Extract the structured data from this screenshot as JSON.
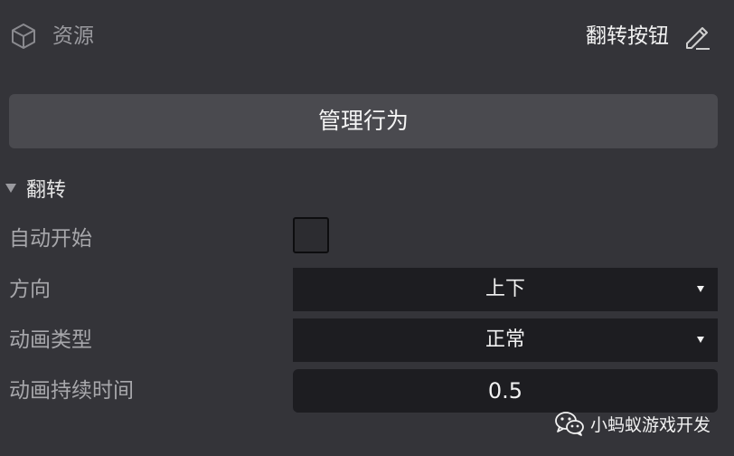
{
  "header": {
    "resource_icon": "cube-icon",
    "resource_label": "资源",
    "object_name": "翻转按钮",
    "edit_icon": "pencil-edit-icon"
  },
  "manage_button": {
    "label": "管理行为"
  },
  "section": {
    "title": "翻转",
    "expanded": true,
    "fields": {
      "auto_start": {
        "label": "自动开始",
        "checked": false
      },
      "direction": {
        "label": "方向",
        "value": "上下"
      },
      "animation_type": {
        "label": "动画类型",
        "value": "正常"
      },
      "duration": {
        "label": "动画持续时间",
        "value": "0.5"
      }
    }
  },
  "watermark": {
    "icon": "wechat-icon",
    "text": "小蚂蚁游戏开发"
  },
  "colors": {
    "panel_bg": "#343439",
    "button_bg": "#4a4a4f",
    "field_bg": "#1d1d21",
    "label_text": "#a7a7ab",
    "value_text": "#f2f2f2"
  }
}
